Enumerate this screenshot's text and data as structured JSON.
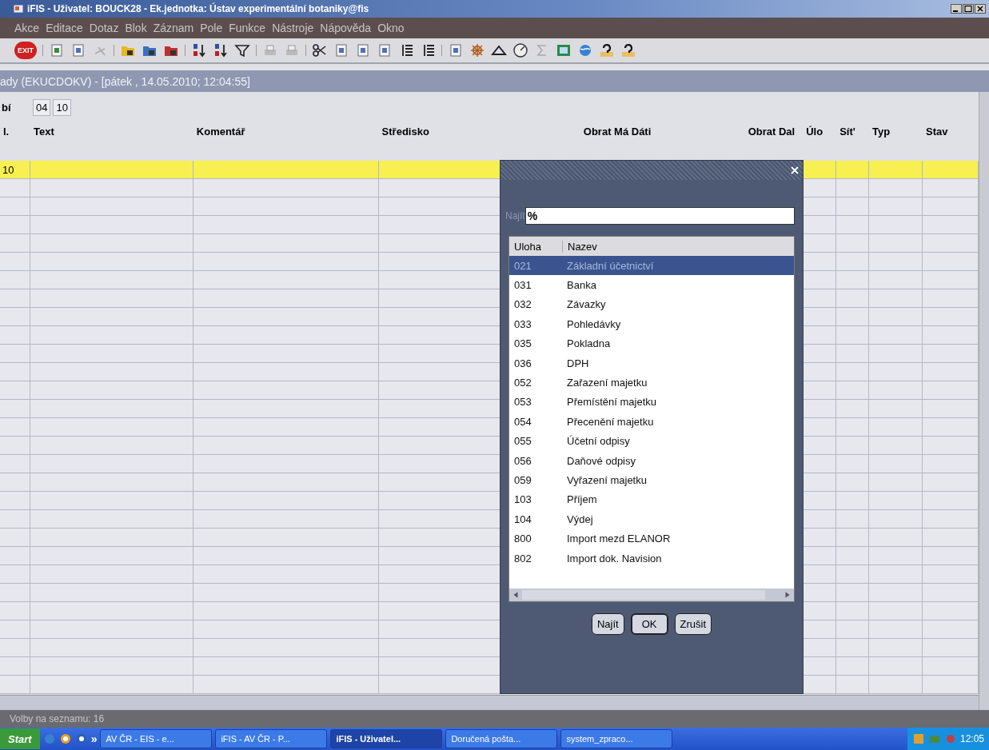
{
  "window": {
    "title": "iFIS - Uživatel: BOUCK28 - Ek.jednotka: Ústav experimentální botaniky@fis"
  },
  "menu": [
    "Akce",
    "Editace",
    "Dotaz",
    "Blok",
    "Záznam",
    "Pole",
    "Funkce",
    "Nástroje",
    "Nápověda",
    "Okno"
  ],
  "toolbar": {
    "exit_label": "EXIT"
  },
  "form": {
    "title": "ady (EKUCDOKV) - [pátek , 14.05.2010; 12:04:55]",
    "record_label": "bí",
    "record_fields": [
      "04",
      "10"
    ]
  },
  "table": {
    "columns": [
      "l.",
      "Text",
      "Komentář",
      "Středisko",
      "Obrat Má Dáti",
      "Obrat Dal",
      "Úlo",
      "Sít'",
      "Typ",
      "Stav"
    ],
    "rows": [
      {
        "cells": [
          "10"
        ],
        "selected": true
      }
    ]
  },
  "dialog": {
    "search_label": "Najít",
    "search_value": "%",
    "columns": [
      "Uloha",
      "Nazev"
    ],
    "items": [
      {
        "code": "021",
        "name": "Základní účetnictví",
        "selected": true
      },
      {
        "code": "031",
        "name": "Banka",
        "selected": false
      },
      {
        "code": "032",
        "name": "Závazky",
        "selected": false
      },
      {
        "code": "033",
        "name": "Pohledávky",
        "selected": false
      },
      {
        "code": "035",
        "name": "Pokladna",
        "selected": false
      },
      {
        "code": "036",
        "name": "DPH",
        "selected": false
      },
      {
        "code": "052",
        "name": "Zařazení majetku",
        "selected": false
      },
      {
        "code": "053",
        "name": "Přemístění majetku",
        "selected": false
      },
      {
        "code": "054",
        "name": "Přecenění majetku",
        "selected": false
      },
      {
        "code": "055",
        "name": "Účetní odpisy",
        "selected": false
      },
      {
        "code": "056",
        "name": "Daňové odpisy",
        "selected": false
      },
      {
        "code": "059",
        "name": "Vyřazení majetku",
        "selected": false
      },
      {
        "code": "103",
        "name": "Příjem",
        "selected": false
      },
      {
        "code": "104",
        "name": "Výdej",
        "selected": false
      },
      {
        "code": "800",
        "name": "Import mezd ELANOR",
        "selected": false
      },
      {
        "code": "802",
        "name": "Import dok. Navision",
        "selected": false
      }
    ],
    "buttons": [
      {
        "label": "Najít",
        "default": false
      },
      {
        "label": "OK",
        "default": true
      },
      {
        "label": "Zrušit",
        "default": false
      }
    ]
  },
  "status_bar": {
    "text": "Volby na seznamu: 16"
  },
  "taskbar": {
    "start": "Start",
    "more": "»",
    "tasks": [
      {
        "label": "AV ČR - EIS - e...",
        "selected": false
      },
      {
        "label": "iFIS - AV ČR - P...",
        "selected": false
      },
      {
        "label": "iFIS - Uživatel...",
        "selected": true
      },
      {
        "label": "Doručená pošta...",
        "selected": false
      },
      {
        "label": "system_zpraco...",
        "selected": false
      }
    ],
    "clock": "12:05"
  }
}
